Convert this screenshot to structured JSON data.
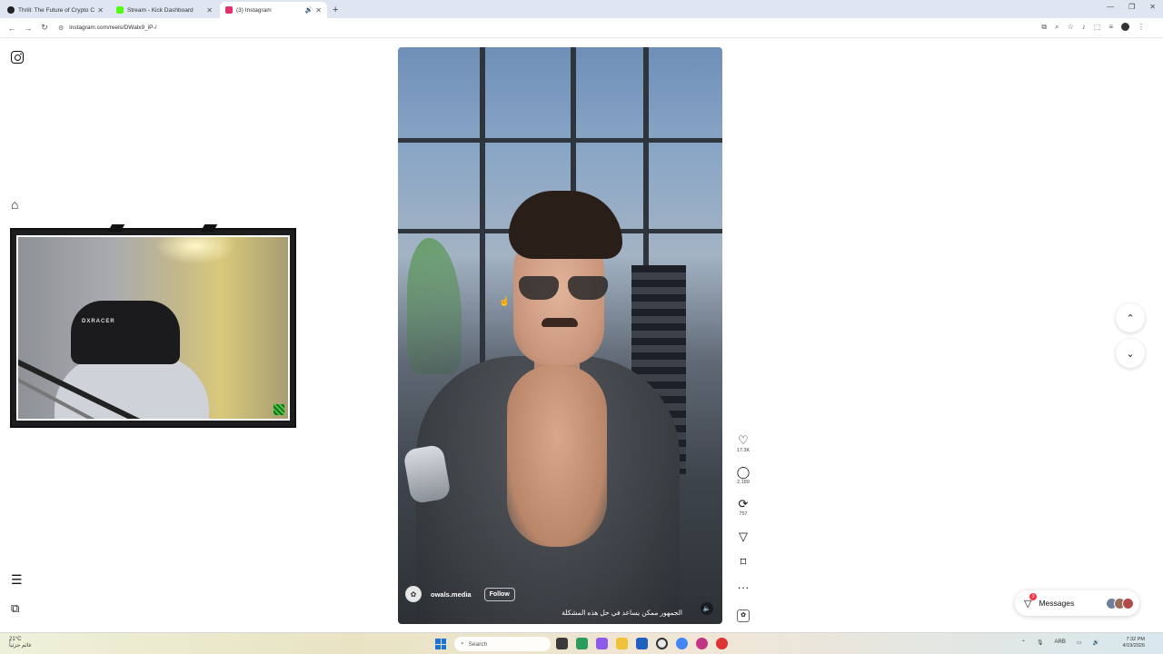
{
  "browser": {
    "tabs": [
      {
        "title": "Thrill: The Future of Crypto Ca",
        "favicon_color": "#222222",
        "active": false
      },
      {
        "title": "Stream - Kick Dashboard",
        "favicon_color": "#53fc18",
        "active": false
      },
      {
        "title": "(3) Instagram",
        "favicon_color": "#e1306c",
        "active": true
      }
    ],
    "url": "instagram.com/reels/DWalx9_iP-/"
  },
  "webcam": {
    "chair_label": "DXRACER"
  },
  "reel": {
    "username": "owals.media",
    "follow_label": "Follow",
    "caption": "الجمهور ممكن يساعد في حل هذه المشكلة",
    "likes": "17.3K",
    "comments": "2,189",
    "reposts": "757"
  },
  "messages": {
    "label": "Messages",
    "badge": "3"
  },
  "taskbar": {
    "temp": "21°C",
    "weather_text": "غائم جزئياً",
    "search_placeholder": "Search",
    "lang": "ARB",
    "time": "7:32 PM",
    "date": "4/19/2026"
  },
  "colors": {
    "accent_blue": "#1a73d9",
    "ig_badge": "#ff3040"
  }
}
